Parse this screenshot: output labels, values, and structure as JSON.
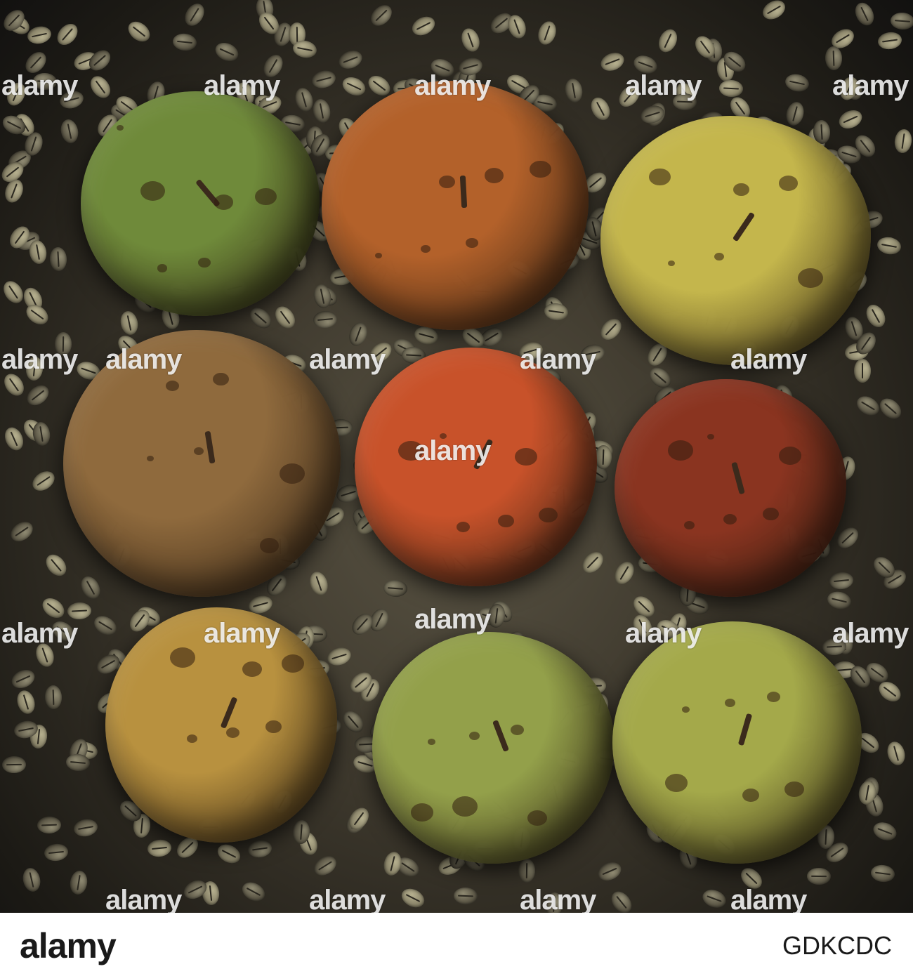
{
  "watermark_text": "alamy",
  "footer": {
    "logo_text": "alamy",
    "image_id_text": "GDKCDC"
  },
  "colors": {
    "background_dark": "#1c1a15",
    "coffee_bean": "#8d876c",
    "footer_bg": "#ffffff",
    "footer_text": "#1a1a1a"
  },
  "apples": [
    {
      "color": "#6f8a3a",
      "state": "rotten"
    },
    {
      "color": "#b3612a",
      "state": "rotten"
    },
    {
      "color": "#c4b64c",
      "state": "rotten"
    },
    {
      "color": "#8f6a3d",
      "state": "rotten"
    },
    {
      "color": "#c8522a",
      "state": "rotten"
    },
    {
      "color": "#8a3420",
      "state": "rotten"
    },
    {
      "color": "#b8913f",
      "state": "rotten"
    },
    {
      "color": "#93a04a",
      "state": "rotten"
    },
    {
      "color": "#a4a94a",
      "state": "rotten"
    }
  ]
}
